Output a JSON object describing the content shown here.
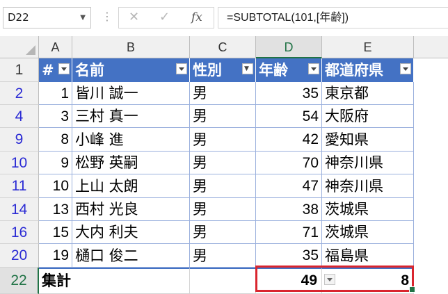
{
  "formula_bar": {
    "name_box": "D22",
    "cancel_icon": "✕",
    "enter_icon": "✓",
    "fx_label": "fx",
    "formula": "=SUBTOTAL(101,[年齢])"
  },
  "columns": [
    "A",
    "B",
    "C",
    "D",
    "E"
  ],
  "row_numbers": [
    "1",
    "2",
    "4",
    "9",
    "10",
    "11",
    "14",
    "16",
    "20",
    "22"
  ],
  "table": {
    "headers": [
      "#",
      "名前",
      "性別",
      "年齢",
      "都道府県"
    ],
    "rows": [
      [
        "1",
        "皆川 誠一",
        "男",
        "35",
        "東京都"
      ],
      [
        "3",
        "三村 真一",
        "男",
        "54",
        "大阪府"
      ],
      [
        "8",
        "小峰 進",
        "男",
        "42",
        "愛知県"
      ],
      [
        "9",
        "松野 英嗣",
        "男",
        "70",
        "神奈川県"
      ],
      [
        "10",
        "上山 太朗",
        "男",
        "47",
        "神奈川県"
      ],
      [
        "13",
        "西村 光良",
        "男",
        "38",
        "茨城県"
      ],
      [
        "15",
        "大内 利夫",
        "男",
        "71",
        "茨城県"
      ],
      [
        "19",
        "樋口 俊二",
        "男",
        "35",
        "福島県"
      ]
    ],
    "total": {
      "label": "集計",
      "age": "49",
      "pref": "8"
    }
  },
  "colors": {
    "header_fill": "#4472c4",
    "selection": "#d9252e",
    "excel_green": "#217346"
  }
}
